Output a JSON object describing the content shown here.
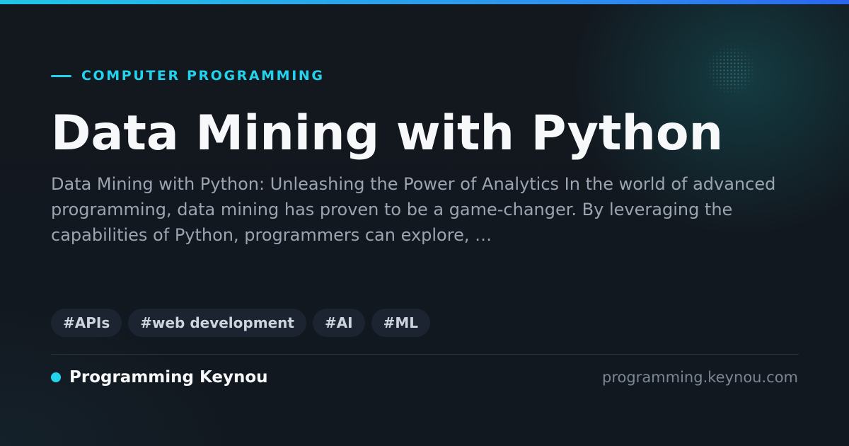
{
  "category": {
    "label": "COMPUTER PROGRAMMING"
  },
  "article": {
    "title": "Data Mining with Python",
    "description": "Data Mining with Python: Unleashing the Power of Analytics In the world of advanced programming, data mining has proven to be a game-changer. By leveraging the capabilities of Python, programmers can explore, …"
  },
  "tags": [
    "#APIs",
    "#web development",
    "#AI",
    "#ML"
  ],
  "footer": {
    "brand_name": "Programming Keynou",
    "site_url": "programming.keynou.com"
  },
  "colors": {
    "accent": "#22d3ee",
    "background": "#12161d",
    "title_text": "#f7f8fa",
    "description_text": "#9ba4b1",
    "tag_background": "#1b2430",
    "url_text": "#7c8593"
  }
}
